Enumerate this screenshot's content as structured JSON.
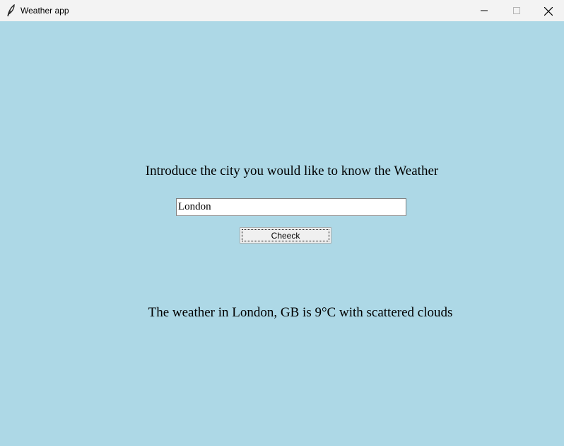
{
  "window": {
    "title": "Weather app",
    "app_icon": "feather-icon",
    "controls": [
      "minimize-icon",
      "maximize-icon",
      "close-icon"
    ]
  },
  "colors": {
    "background": "#add8e6",
    "titlebar": "#f3f3f3"
  },
  "main": {
    "prompt": "Introduce the city you would like to know the Weather",
    "city_input": {
      "value": "London"
    },
    "check_button_label": "Cheeck",
    "result": "The weather in London, GB is 9°C with scattered clouds"
  }
}
